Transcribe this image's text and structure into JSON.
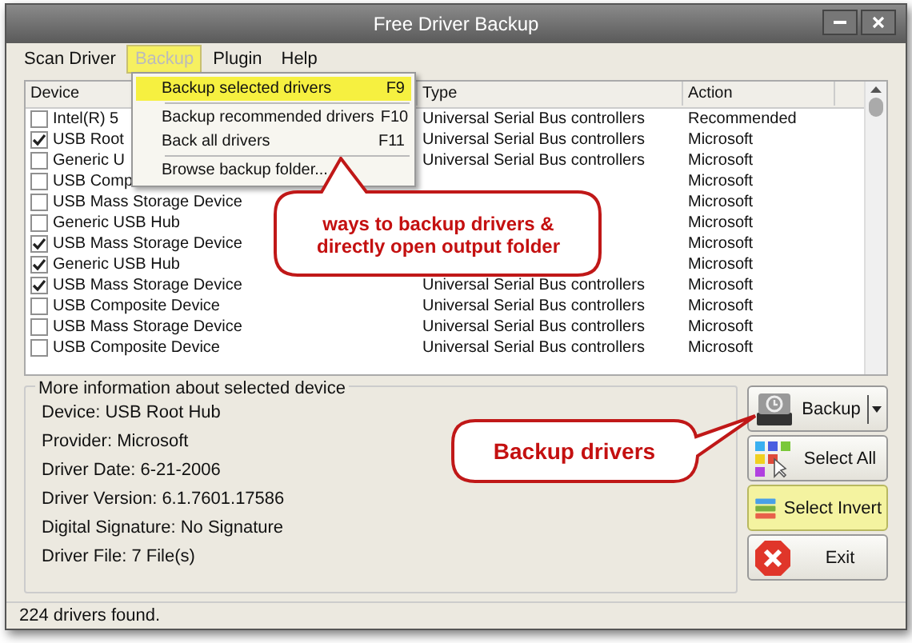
{
  "window": {
    "title": "Free Driver Backup"
  },
  "menu_bar": [
    {
      "label": "Scan Driver",
      "selected": false
    },
    {
      "label": "Backup",
      "selected": true
    },
    {
      "label": "Plugin",
      "selected": false
    },
    {
      "label": "Help",
      "selected": false
    }
  ],
  "backup_menu": [
    {
      "label": "Backup selected drivers",
      "shortcut": "F9",
      "selected": true,
      "separator_after": true
    },
    {
      "label": "Backup recommended drivers",
      "shortcut": "F10",
      "selected": false,
      "separator_after": false
    },
    {
      "label": "Back all drivers",
      "shortcut": "F11",
      "selected": false,
      "separator_after": true
    },
    {
      "label": "Browse backup folder...",
      "selected": false,
      "separator_after": false
    }
  ],
  "table": {
    "columns": [
      "Device",
      "Type",
      "Action"
    ],
    "rows": [
      {
        "device": "Intel(R) 5",
        "checked": false,
        "type": "Universal Serial Bus controllers",
        "action": "Recommended"
      },
      {
        "device": "USB Root",
        "checked": true,
        "type": "Universal Serial Bus controllers",
        "action": "Microsoft"
      },
      {
        "device": "Generic U",
        "checked": false,
        "type": "Universal Serial Bus controllers",
        "action": "Microsoft"
      },
      {
        "device": "USB Comp",
        "checked": false,
        "action": "Microsoft"
      },
      {
        "device": "USB Mass Storage Device",
        "checked": false,
        "action": "Microsoft"
      },
      {
        "device": "Generic USB Hub",
        "checked": false,
        "action": "Microsoft"
      },
      {
        "device": "USB Mass Storage Device",
        "checked": true,
        "action": "Microsoft"
      },
      {
        "device": "Generic USB Hub",
        "checked": true,
        "action": "Microsoft"
      },
      {
        "device": "USB Mass Storage Device",
        "checked": true,
        "type": "Universal Serial Bus controllers",
        "action": "Microsoft"
      },
      {
        "device": "USB Composite Device",
        "checked": false,
        "type": "Universal Serial Bus controllers",
        "action": "Microsoft"
      },
      {
        "device": "USB Mass Storage Device",
        "checked": false,
        "type": "Universal Serial Bus controllers",
        "action": "Microsoft"
      },
      {
        "device": "USB Composite Device",
        "checked": false,
        "type": "Universal Serial Bus controllers",
        "action": "Microsoft"
      }
    ]
  },
  "info": {
    "title": "More information about selected device",
    "lines": [
      "Device:  USB Root Hub",
      "Provider: Microsoft",
      "Driver Date: 6-21-2006",
      "Driver Version: 6.1.7601.17586",
      "Digital Signature: No Signature",
      "Driver File: 7 File(s)"
    ]
  },
  "buttons": [
    {
      "kind": "backup",
      "label": "Backup",
      "selected": false
    },
    {
      "kind": "select_all",
      "label": "Select All",
      "selected": false
    },
    {
      "kind": "select_invert",
      "label": "Select Invert",
      "selected": true
    },
    {
      "kind": "exit",
      "label": "Exit",
      "selected": false
    }
  ],
  "callouts": [
    {
      "text": "ways to backup drivers & directly open output folder"
    },
    {
      "text": "Backup drivers"
    }
  ],
  "status_bar": "224 drivers found."
}
